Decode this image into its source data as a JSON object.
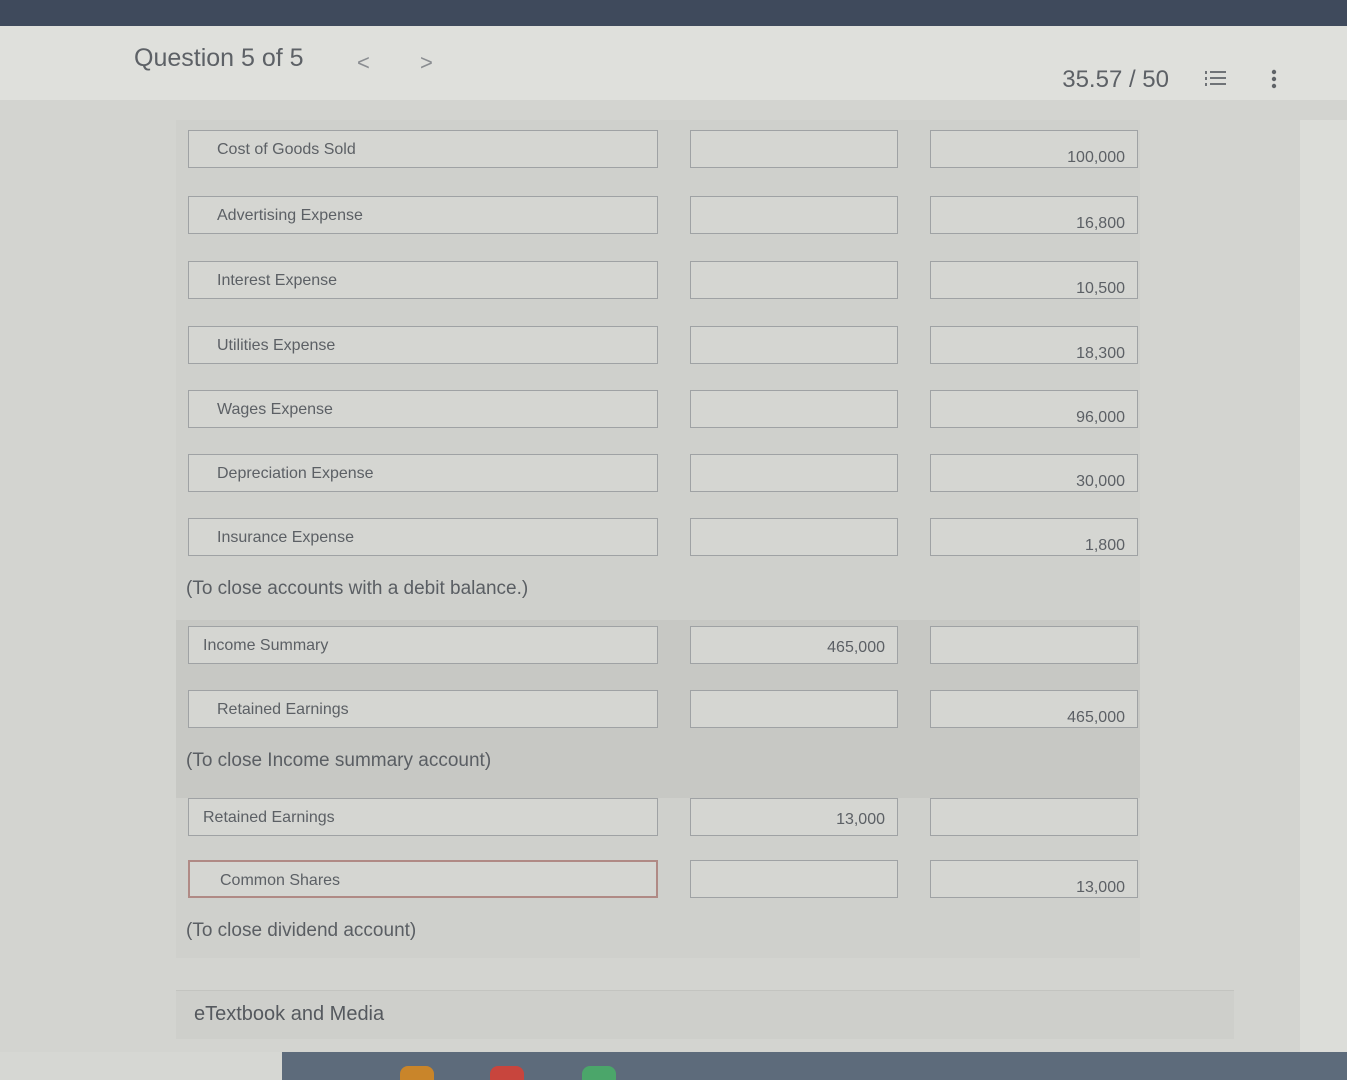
{
  "header": {
    "question_label": "Question 5 of 5",
    "prev_symbol": "<",
    "next_symbol": ">",
    "score": "35.57 / 50"
  },
  "entries": [
    {
      "account": "Cost of Goods Sold",
      "debit": "",
      "credit": "100,000"
    },
    {
      "account": "Advertising Expense",
      "debit": "",
      "credit": "16,800"
    },
    {
      "account": "Interest Expense",
      "debit": "",
      "credit": "10,500"
    },
    {
      "account": "Utilities Expense",
      "debit": "",
      "credit": "18,300"
    },
    {
      "account": "Wages Expense",
      "debit": "",
      "credit": "96,000"
    },
    {
      "account": "Depreciation Expense",
      "debit": "",
      "credit": "30,000"
    },
    {
      "account": "Insurance Expense",
      "debit": "",
      "credit": "1,800"
    },
    {
      "account": "Income Summary",
      "debit": "465,000",
      "credit": ""
    },
    {
      "account": "Retained Earnings",
      "debit": "",
      "credit": "465,000"
    },
    {
      "account": "Retained Earnings",
      "debit": "13,000",
      "credit": ""
    },
    {
      "account": "Common Shares",
      "debit": "",
      "credit": "13,000"
    }
  ],
  "notes": {
    "debit_close": "(To close accounts with a debit balance.)",
    "income_close": "(To close Income summary account)",
    "dividend_close": "(To close dividend account)"
  },
  "footer": {
    "etextbook_label": "eTextbook and Media"
  },
  "colors": {
    "top_strip": "#3f4a5c",
    "taskbar": "#5d6b7b",
    "common_shares_border": "#b08a85"
  }
}
